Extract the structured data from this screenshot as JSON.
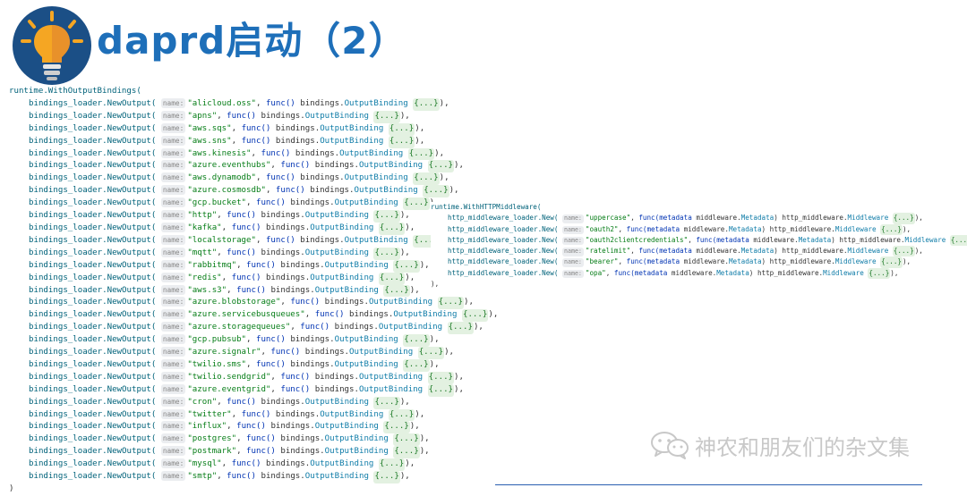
{
  "header": {
    "title": "daprd启动（2）",
    "icon": "lightbulb-icon"
  },
  "left_code": {
    "call": "runtime.WithOutputBindings(",
    "loader_fn": "bindings_loader.NewOutput(",
    "param_hint": "name:",
    "func_kw": "func()",
    "pkg": "bindings.",
    "ret_type": "OutputBinding",
    "fold": "{...}",
    "line_end": "),",
    "bindings": [
      "\"alicloud.oss\"",
      "\"apns\"",
      "\"aws.sqs\"",
      "\"aws.sns\"",
      "\"aws.kinesis\"",
      "\"azure.eventhubs\"",
      "\"aws.dynamodb\"",
      "\"azure.cosmosdb\"",
      "\"gcp.bucket\"",
      "\"http\"",
      "\"kafka\"",
      "\"localstorage\"",
      "\"mqtt\"",
      "\"rabbitmq\"",
      "\"redis\"",
      "\"aws.s3\"",
      "\"azure.blobstorage\"",
      "\"azure.servicebusqueues\"",
      "\"azure.storagequeues\"",
      "\"gcp.pubsub\"",
      "\"azure.signalr\"",
      "\"twilio.sms\"",
      "\"twilio.sendgrid\"",
      "\"azure.eventgrid\"",
      "\"cron\"",
      "\"twitter\"",
      "\"influx\"",
      "\"postgres\"",
      "\"postmark\"",
      "\"mysql\"",
      "\"smtp\""
    ],
    "close": ")"
  },
  "right_code": {
    "call": "runtime.WithHTTPMiddleware(",
    "loader_fn": "http_middleware_loader.New(",
    "param_hint": "name:",
    "func_sig_start": "func(metadata",
    "meta_pkg": "middleware.",
    "meta_type": "Metadata",
    "ret_pkg": "http_middleware.",
    "ret_type": "Middleware",
    "fold": "{...}",
    "line_end": "),",
    "middlewares": [
      "\"uppercase\"",
      "\"oauth2\"",
      "\"oauth2clientcredentials\"",
      "\"ratelimit\"",
      "\"bearer\"",
      "\"opa\""
    ],
    "close": "),"
  },
  "watermark": {
    "icon": "wechat-icon",
    "text": "神农和朋友们的杂文集"
  }
}
